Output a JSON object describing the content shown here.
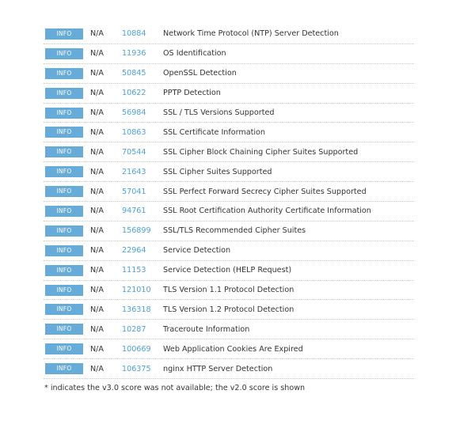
{
  "rows": [
    {
      "severity": "INFO",
      "score": "N/A",
      "plugin_id": "10884",
      "name": "Network Time Protocol (NTP) Server Detection"
    },
    {
      "severity": "INFO",
      "score": "N/A",
      "plugin_id": "11936",
      "name": "OS Identification"
    },
    {
      "severity": "INFO",
      "score": "N/A",
      "plugin_id": "50845",
      "name": "OpenSSL Detection"
    },
    {
      "severity": "INFO",
      "score": "N/A",
      "plugin_id": "10622",
      "name": "PPTP Detection"
    },
    {
      "severity": "INFO",
      "score": "N/A",
      "plugin_id": "56984",
      "name": "SSL / TLS Versions Supported"
    },
    {
      "severity": "INFO",
      "score": "N/A",
      "plugin_id": "10863",
      "name": "SSL Certificate Information"
    },
    {
      "severity": "INFO",
      "score": "N/A",
      "plugin_id": "70544",
      "name": "SSL Cipher Block Chaining Cipher Suites Supported"
    },
    {
      "severity": "INFO",
      "score": "N/A",
      "plugin_id": "21643",
      "name": "SSL Cipher Suites Supported"
    },
    {
      "severity": "INFO",
      "score": "N/A",
      "plugin_id": "57041",
      "name": "SSL Perfect Forward Secrecy Cipher Suites Supported"
    },
    {
      "severity": "INFO",
      "score": "N/A",
      "plugin_id": "94761",
      "name": "SSL Root Certification Authority Certificate Information"
    },
    {
      "severity": "INFO",
      "score": "N/A",
      "plugin_id": "156899",
      "name": "SSL/TLS Recommended Cipher Suites"
    },
    {
      "severity": "INFO",
      "score": "N/A",
      "plugin_id": "22964",
      "name": "Service Detection"
    },
    {
      "severity": "INFO",
      "score": "N/A",
      "plugin_id": "11153",
      "name": "Service Detection (HELP Request)"
    },
    {
      "severity": "INFO",
      "score": "N/A",
      "plugin_id": "121010",
      "name": "TLS Version 1.1 Protocol Detection"
    },
    {
      "severity": "INFO",
      "score": "N/A",
      "plugin_id": "136318",
      "name": "TLS Version 1.2 Protocol Detection"
    },
    {
      "severity": "INFO",
      "score": "N/A",
      "plugin_id": "10287",
      "name": "Traceroute Information"
    },
    {
      "severity": "INFO",
      "score": "N/A",
      "plugin_id": "100669",
      "name": "Web Application Cookies Are Expired"
    },
    {
      "severity": "INFO",
      "score": "N/A",
      "plugin_id": "106375",
      "name": "nginx HTTP Server Detection"
    }
  ],
  "footnote": "* indicates the v3.0 score was not available; the v2.0 score is shown",
  "colors": {
    "badge_bg": "#67acd9",
    "plugin_link": "#4da0d8",
    "text": "#333333"
  }
}
